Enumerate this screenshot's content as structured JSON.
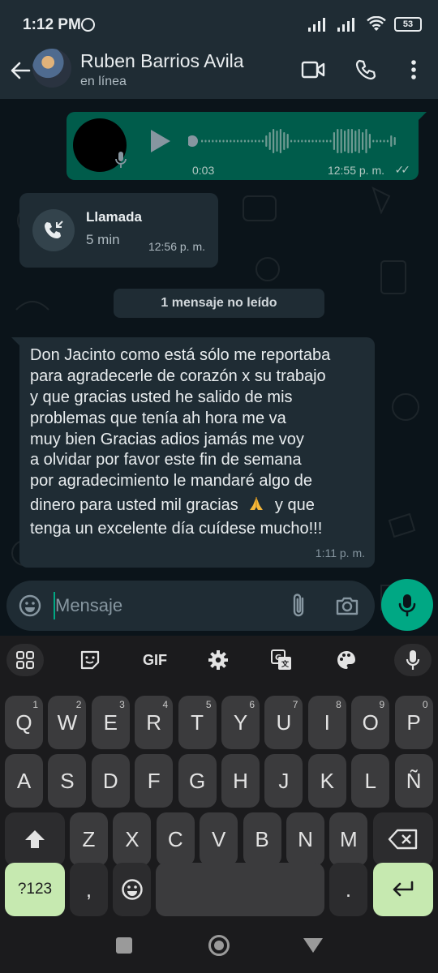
{
  "status_bar": {
    "time": "1:12 PM",
    "battery": "53"
  },
  "header": {
    "contact_name": "Ruben Barrios Avila",
    "status": "en línea"
  },
  "messages": {
    "voice": {
      "duration": "0:03",
      "time": "12:55 p. m."
    },
    "call": {
      "title": "Llamada",
      "duration": "5 min",
      "time": "12:56 p. m."
    },
    "unread_divider": "1 mensaje no leído",
    "incoming": {
      "lines": [
        "Don Jacinto como está sólo me reportaba",
        "para agradecerle de corazón x su trabajo",
        "y que gracias usted he salido de mis",
        "problemas que tenía ah hora me va",
        "muy bien Gracias adios jamás me voy",
        "a olvidar por favor este fin de semana",
        "por agradecimiento le mandaré algo de"
      ],
      "line8_before": "dinero para usted mil gracias",
      "line8_after": "y que",
      "line9": "tenga un excelente día cuídese mucho!!!",
      "time": "1:11 p. m."
    }
  },
  "compose": {
    "placeholder": "Mensaje"
  },
  "keyboard": {
    "toolbar": {
      "gif": "GIF"
    },
    "row1": [
      {
        "k": "Q",
        "n": "1"
      },
      {
        "k": "W",
        "n": "2"
      },
      {
        "k": "E",
        "n": "3"
      },
      {
        "k": "R",
        "n": "4"
      },
      {
        "k": "T",
        "n": "5"
      },
      {
        "k": "Y",
        "n": "6"
      },
      {
        "k": "U",
        "n": "7"
      },
      {
        "k": "I",
        "n": "8"
      },
      {
        "k": "O",
        "n": "9"
      },
      {
        "k": "P",
        "n": "0"
      }
    ],
    "row2": [
      "A",
      "S",
      "D",
      "F",
      "G",
      "H",
      "J",
      "K",
      "L",
      "Ñ"
    ],
    "row3": [
      "Z",
      "X",
      "C",
      "V",
      "B",
      "N",
      "M"
    ],
    "symbols": "?123",
    "comma": ",",
    "period": "."
  },
  "colors": {
    "accent": "#00a884",
    "outgoing_bubble": "#005c4b",
    "incoming_bubble": "#1f2c34",
    "keyboard_action": "#c6e9b0"
  },
  "icons": [
    "back-arrow-icon",
    "video-call-icon",
    "phone-icon",
    "more-icon",
    "play-icon",
    "mic-icon",
    "missed-call-icon",
    "emoji-icon",
    "attach-icon",
    "camera-icon",
    "apps-grid-icon",
    "sticker-icon",
    "settings-icon",
    "translate-icon",
    "palette-icon",
    "shift-icon",
    "backspace-icon",
    "enter-icon",
    "folded-hands-icon"
  ]
}
